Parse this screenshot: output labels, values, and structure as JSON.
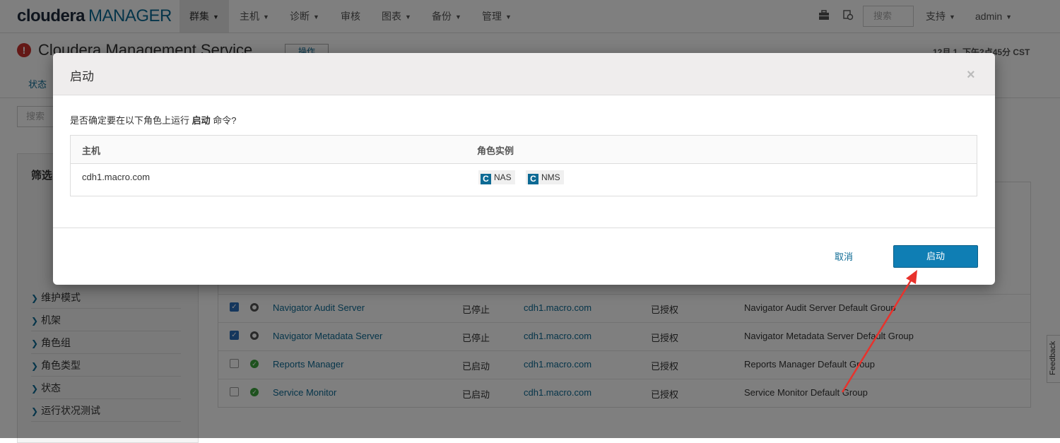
{
  "navbar": {
    "logo_main": "cloudera",
    "logo_sub": "MANAGER",
    "items": [
      {
        "label": "群集"
      },
      {
        "label": "主机"
      },
      {
        "label": "诊断"
      },
      {
        "label": "审核"
      },
      {
        "label": "图表"
      },
      {
        "label": "备份"
      },
      {
        "label": "管理"
      }
    ],
    "search_placeholder": "搜索",
    "support": "支持",
    "user": "admin"
  },
  "page": {
    "title": "Cloudera Management Service",
    "actions_label": "操作",
    "timestamp": "12月 1, 下午2点45分 CST",
    "subnav_status": "状态",
    "search_placeholder": "搜索",
    "filters_title": "筛选",
    "filter_items": [
      "维护模式",
      "机架",
      "角色组",
      "角色类型",
      "状态",
      "运行状况测试"
    ]
  },
  "roles": [
    {
      "name": "Navigator Audit Server",
      "state": "已停止",
      "host": "cdh1.macro.com",
      "commission": "已授权",
      "group": "Navigator Audit Server Default Group",
      "checked": true,
      "status": "stopped"
    },
    {
      "name": "Navigator Metadata Server",
      "state": "已停止",
      "host": "cdh1.macro.com",
      "commission": "已授权",
      "group": "Navigator Metadata Server Default Group",
      "checked": true,
      "status": "stopped"
    },
    {
      "name": "Reports Manager",
      "state": "已启动",
      "host": "cdh1.macro.com",
      "commission": "已授权",
      "group": "Reports Manager Default Group",
      "checked": false,
      "status": "started"
    },
    {
      "name": "Service Monitor",
      "state": "已启动",
      "host": "cdh1.macro.com",
      "commission": "已授权",
      "group": "Service Monitor Default Group",
      "checked": false,
      "status": "started"
    }
  ],
  "modal": {
    "title": "启动",
    "close": "×",
    "confirm_prefix": "是否确定要在以下角色上运行",
    "confirm_command": "启动",
    "confirm_suffix": "命令?",
    "col_host": "主机",
    "col_roles": "角色实例",
    "host": "cdh1.macro.com",
    "role_badges": [
      "NAS",
      "NMS"
    ],
    "badge_icon": "C",
    "cancel_label": "取消",
    "start_label": "启动"
  },
  "feedback": "Feedback",
  "colors": {
    "primary": "#0f7eb4",
    "link": "#0d6a94",
    "annotation_arrow": "#e8322c"
  },
  "icons": {
    "toolbox": "toolbox-icon",
    "running_commands": "running-commands-icon",
    "error": "error-icon"
  }
}
